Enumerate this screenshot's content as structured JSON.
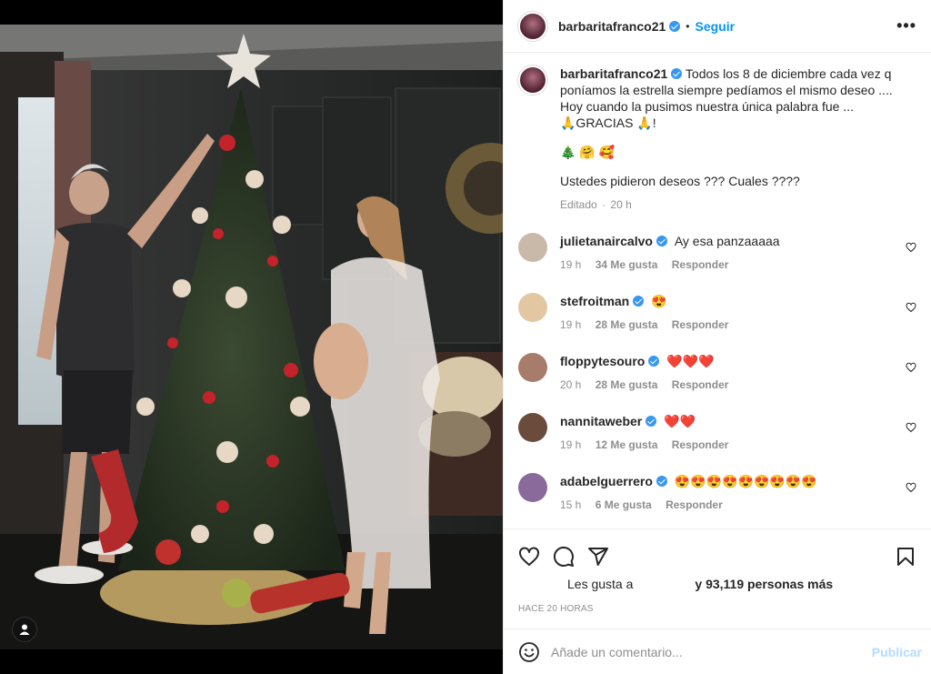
{
  "header": {
    "username": "barbaritafranco21",
    "separator": "•",
    "follow_label": "Seguir",
    "more_label": "•••"
  },
  "caption": {
    "username": "barbaritafranco21",
    "line1": "Todos los 8 de diciembre cada vez q poníamos la estrella siempre pedíamos el mismo deseo .... Hoy cuando la pusimos nuestra única palabra fue ...",
    "line2": "🙏GRACIAS 🙏!",
    "line3": "🎄 🤗 🥰",
    "line4": "Ustedes pidieron deseos ??? Cuales ????",
    "edited": "Editado",
    "time": "20 h"
  },
  "comments": [
    {
      "username": "julietanaircalvo",
      "text": "Ay esa panzaaaaa",
      "time": "19 h",
      "likes": "34 Me gusta",
      "reply": "Responder",
      "avatar_color": "#c9b9a8"
    },
    {
      "username": "stefroitman",
      "text": "😍",
      "time": "19 h",
      "likes": "28 Me gusta",
      "reply": "Responder",
      "avatar_color": "#e2c7a2"
    },
    {
      "username": "floppytesouro",
      "text": "❤️❤️❤️",
      "time": "20 h",
      "likes": "28 Me gusta",
      "reply": "Responder",
      "avatar_color": "#a77c6a"
    },
    {
      "username": "nannitaweber",
      "text": "❤️❤️",
      "time": "19 h",
      "likes": "12 Me gusta",
      "reply": "Responder",
      "avatar_color": "#6b4c3c"
    },
    {
      "username": "adabelguerrero",
      "text": "😍😍😍😍😍😍😍😍😍",
      "time": "15 h",
      "likes": "6 Me gusta",
      "reply": "Responder",
      "avatar_color": "#8a6a9a"
    }
  ],
  "actions": {
    "like_icon": "heart-icon",
    "comment_icon": "comment-icon",
    "share_icon": "share-icon",
    "save_icon": "bookmark-icon"
  },
  "likes": {
    "prefix": "Les gusta a",
    "count": "y 93,119 personas más"
  },
  "timestamp": "HACE 20 HORAS",
  "add_comment": {
    "placeholder": "Añade un comentario...",
    "post_label": "Publicar"
  },
  "colors": {
    "accent": "#0095f6",
    "verified": "#3897f0",
    "muted": "#8e8e8e"
  }
}
